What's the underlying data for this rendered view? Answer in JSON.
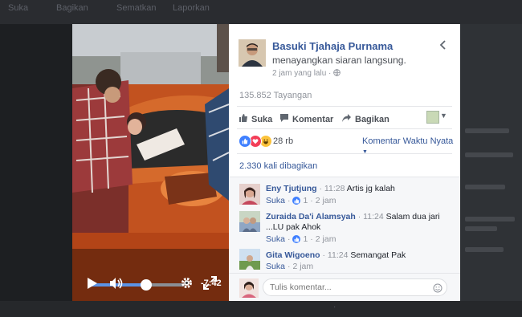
{
  "background": {
    "top_nav": [
      "Suka",
      "Bagikan",
      "Sematkan",
      "Laporkan"
    ]
  },
  "video": {
    "time_remaining": "-7:42",
    "progress": 0.6,
    "accent": "#5b93e6"
  },
  "post": {
    "author": "Basuki Tjahaja Purnama",
    "action": "menayangkan siaran langsung.",
    "timestamp": "2 jam yang lalu",
    "audience_icon": "globe-icon",
    "views": "135.852 Tayangan",
    "actions": {
      "like": "Suka",
      "comment": "Komentar",
      "share": "Bagikan"
    },
    "reactions": {
      "types": [
        "like",
        "love",
        "haha"
      ],
      "count": "28 rb"
    },
    "comment_order": "Komentar Waktu Nyata",
    "shares": "2.330 kali dibagikan",
    "link_color": "#365899"
  },
  "comments": [
    {
      "name": "Eny Tjutjung",
      "time": "11:28",
      "text": "Artis jg kalah",
      "like": "Suka",
      "likes": "1",
      "age": "2 jam"
    },
    {
      "name": "Zuraida Da'i Alamsyah",
      "time": "11:24",
      "text": "Salam dua jari ...LU pak Ahok",
      "like": "Suka",
      "likes": "1",
      "age": "2 jam"
    },
    {
      "name": "Gita Wigoeno",
      "time": "11:24",
      "text": "Semangat Pak",
      "like": "Suka",
      "age": "2 jam"
    }
  ],
  "composer": {
    "placeholder": "Tulis komentar..."
  }
}
